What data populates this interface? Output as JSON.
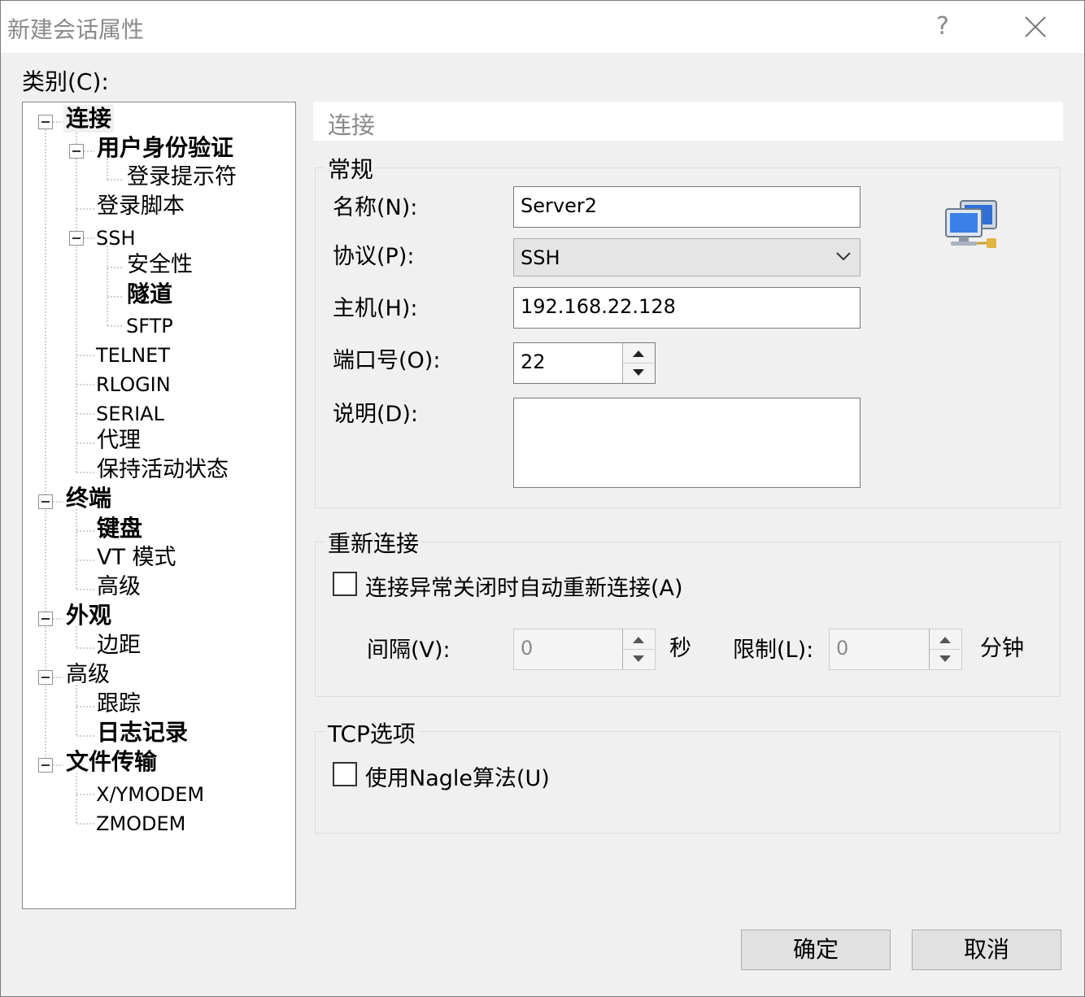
{
  "window": {
    "title": "新建会话属性",
    "help_label": "?"
  },
  "category": {
    "label": "类别(C):"
  },
  "tree": {
    "items": [
      {
        "label": "连接"
      },
      {
        "label": "用户身份验证"
      },
      {
        "label": "登录提示符"
      },
      {
        "label": "登录脚本"
      },
      {
        "label": "SSH"
      },
      {
        "label": "安全性"
      },
      {
        "label": "隧道"
      },
      {
        "label": "SFTP"
      },
      {
        "label": "TELNET"
      },
      {
        "label": "RLOGIN"
      },
      {
        "label": "SERIAL"
      },
      {
        "label": "代理"
      },
      {
        "label": "保持活动状态"
      },
      {
        "label": "终端"
      },
      {
        "label": "键盘"
      },
      {
        "label": "VT 模式"
      },
      {
        "label": "高级"
      },
      {
        "label": "外观"
      },
      {
        "label": "边距"
      },
      {
        "label": "高级"
      },
      {
        "label": "跟踪"
      },
      {
        "label": "日志记录"
      },
      {
        "label": "文件传输"
      },
      {
        "label": "X/YMODEM"
      },
      {
        "label": "ZMODEM"
      }
    ]
  },
  "panel": {
    "header": "连接",
    "general": {
      "title": "常规",
      "name_label": "名称(N):",
      "name_value": "Server2",
      "protocol_label": "协议(P):",
      "protocol_value": "SSH",
      "host_label": "主机(H):",
      "host_value": "192.168.22.128",
      "port_label": "端口号(O):",
      "port_value": "22",
      "desc_label": "说明(D):",
      "desc_value": ""
    },
    "reconnect": {
      "title": "重新连接",
      "auto_label": "连接异常关闭时自动重新连接(A)",
      "interval_label": "间隔(V):",
      "interval_value": "0",
      "seconds_unit": "秒",
      "limit_label": "限制(L):",
      "limit_value": "0",
      "minutes_unit": "分钟"
    },
    "tcp": {
      "title": "TCP选项",
      "nagle_label": "使用Nagle算法(U)"
    }
  },
  "buttons": {
    "ok": "确定",
    "cancel": "取消"
  },
  "icons": {
    "network": "network-computers-icon",
    "close": "close-icon",
    "dropdown": "chevron-down-icon"
  },
  "colors": {
    "title_text": "#8a8a8a",
    "dialog_bg": "#f0f0f0",
    "icon_blue": "#2f6fd6"
  }
}
